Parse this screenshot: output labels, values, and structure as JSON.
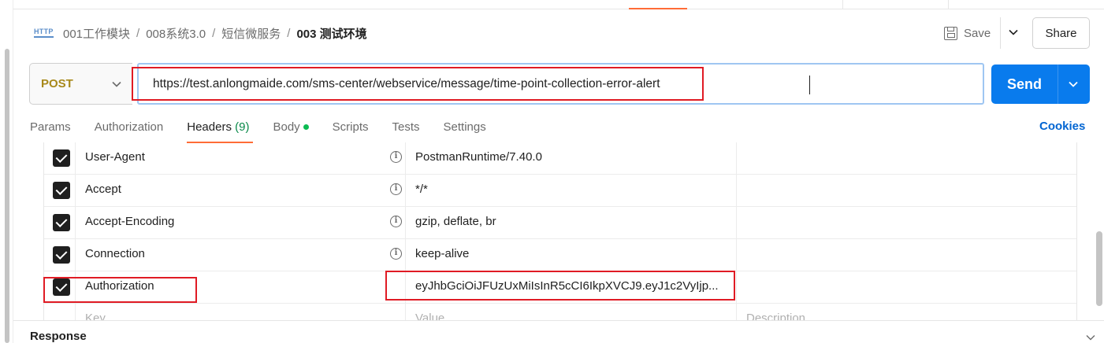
{
  "breadcrumb": {
    "protocol_icon": "HTTP",
    "items": [
      "001工作模块",
      "008系统3.0",
      "短信微服务"
    ],
    "current": "003 测试环境",
    "separator": "/"
  },
  "toolbar": {
    "save_label": "Save",
    "share_label": "Share"
  },
  "request": {
    "method": "POST",
    "url": "https://test.anlongmaide.com/sms-center/webservice/message/time-point-collection-error-alert",
    "send_label": "Send"
  },
  "tabs": {
    "params": "Params",
    "authorization": "Authorization",
    "headers": "Headers",
    "headers_count": "(9)",
    "body": "Body",
    "scripts": "Scripts",
    "tests": "Tests",
    "settings": "Settings",
    "active": "Headers"
  },
  "cookies_label": "Cookies",
  "headers_table": {
    "rows": [
      {
        "key": "User-Agent",
        "value": "PostmanRuntime/7.40.0",
        "checked": true,
        "info": true
      },
      {
        "key": "Accept",
        "value": "*/*",
        "checked": true,
        "info": true
      },
      {
        "key": "Accept-Encoding",
        "value": "gzip, deflate, br",
        "checked": true,
        "info": true
      },
      {
        "key": "Connection",
        "value": "keep-alive",
        "checked": true,
        "info": true
      },
      {
        "key": "Authorization",
        "value": "eyJhbGciOiJFUzUxMiIsInR5cCI6IkpXVCJ9.eyJ1c2VyIjp...",
        "checked": true,
        "info": false
      }
    ],
    "placeholder_key": "Key",
    "placeholder_value": "Value",
    "placeholder_description": "Description"
  },
  "response_label": "Response",
  "colors": {
    "accent_orange": "#ff6c37",
    "send_blue": "#097bed",
    "method_post": "#a8891b",
    "annotation_red": "#e01b24"
  }
}
